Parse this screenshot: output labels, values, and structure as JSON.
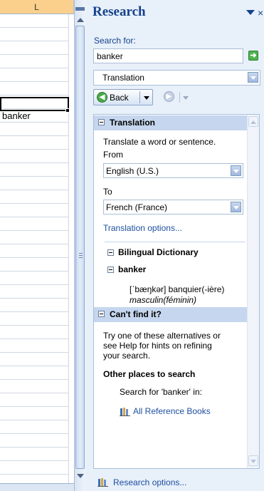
{
  "sheet": {
    "column_header": "L",
    "active_cell_value": "banker"
  },
  "pane": {
    "title": "Research",
    "search_label": "Search for:",
    "search_value": "banker",
    "source_value": "Translation",
    "back_label": "Back",
    "results": {
      "translation_header": "Translation",
      "translate_desc": "Translate a word or sentence.",
      "from_label": "From",
      "from_value": "English (U.S.)",
      "to_label": "To",
      "to_value": "French (France)",
      "options_link": "Translation options...",
      "dictionary_header": "Bilingual Dictionary",
      "word_header": "banker",
      "entry_line": "[ˈbæŋkər] banquier(-ière)",
      "entry_gender": "masculin(féminin)",
      "cantfind_header": "Can't find it?",
      "cantfind_line1": "Try one of these alternatives or",
      "cantfind_line2": "see Help for hints on refining",
      "cantfind_line3": "your search.",
      "other_places": "Other places to search",
      "search_for_in": "Search for 'banker' in:",
      "all_books_link": "All Reference Books"
    },
    "options_link": "Research options..."
  }
}
